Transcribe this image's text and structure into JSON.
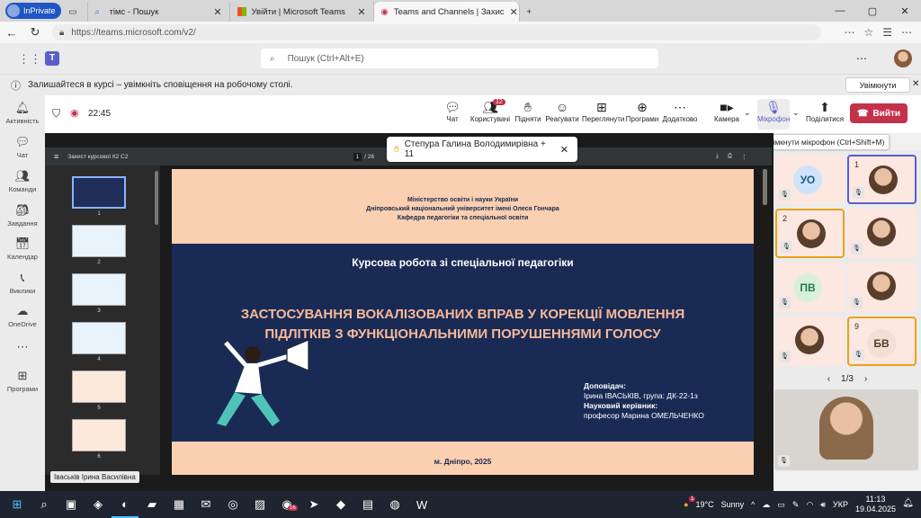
{
  "browser": {
    "inprivate_label": "InPrivate",
    "tabs": [
      {
        "title": "тімс - Пошук",
        "active": false
      },
      {
        "title": "Увійти | Microsoft Teams",
        "active": false
      },
      {
        "title": "Teams and Channels | Захис",
        "active": true
      }
    ],
    "url": "https://teams.microsoft.com/v2/"
  },
  "teams": {
    "search_placeholder": "Пошук (Ctrl+Alt+E)",
    "banner_text": "Залишайтеся в курсі – увімкніть сповіщення на робочому столі.",
    "banner_button": "Увімкнути",
    "rail": [
      "Активність",
      "Чат",
      "Команди",
      "Завдання",
      "Календар",
      "Виклики",
      "OneDrive",
      "Програми"
    ],
    "meeting": {
      "timer": "22:45",
      "toolbar": [
        {
          "label": "Чат",
          "icon": "chat-icon"
        },
        {
          "label": "Користувачі",
          "icon": "people-icon",
          "badge": "12"
        },
        {
          "label": "Підняти",
          "icon": "raise-hand-icon"
        },
        {
          "label": "Реагувати",
          "icon": "smiley-icon"
        },
        {
          "label": "Переглянути",
          "icon": "view-icon"
        },
        {
          "label": "Програми",
          "icon": "apps-icon"
        },
        {
          "label": "Додатково",
          "icon": "more-icon"
        },
        {
          "label": "Камера",
          "icon": "camera-icon"
        },
        {
          "label": "Мікрофон",
          "icon": "mic-off-icon"
        },
        {
          "label": "Поділитися",
          "icon": "share-icon"
        }
      ],
      "leave_label": "Вийти",
      "mic_tooltip": "Увімкнути мікрофон (Ctrl+Shift+M)"
    },
    "presenter_pill": "Степура Галина Володимирівна + 11",
    "presenter_badge": "Іваськів Ірина Василівна",
    "pdf": {
      "title": "Захист курсової К2 С2",
      "page": "1",
      "total": "/ 28",
      "thumb_numbers": [
        "1",
        "2",
        "3",
        "4",
        "5",
        "6"
      ]
    },
    "slide": {
      "ministry": "Міністерство освіти і науки України",
      "university": "Дніпровський національний університет імені Олеся Гончара",
      "department": "Кафедра педагогіки та спеціальної освіти",
      "course": "Курсова робота зі спеціальної педагогіки",
      "title_line1": "ЗАСТОСУВАННЯ ВОКАЛІЗОВАНИХ ВПРАВ У КОРЕКЦІЇ МОВЛЕННЯ",
      "title_line2": "ПІДЛІТКІВ З ФУНКЦІОНАЛЬНИМИ ПОРУШЕННЯМИ ГОЛОСУ",
      "speaker_label": "Доповідач:",
      "speaker": "Ірина ІВАСЬКІВ, група: ДК-22-1з",
      "advisor_label": "Науковий керівник:",
      "advisor": "професор Марина ОМЕЛЬЧЕНКО",
      "city_year": "м. Дніпро, 2025"
    },
    "participants": [
      {
        "initials": "УО",
        "color": "#1a5a8a"
      },
      {
        "hand": "1",
        "photo": true
      },
      {
        "hand": "2",
        "photo": true
      },
      {
        "photo": true
      },
      {
        "initials": "ПВ",
        "color": "#2a7a4a"
      },
      {
        "photo": true
      },
      {
        "photo": true
      },
      {
        "hand": "9",
        "initials": "БВ",
        "color": "#5a3e2c"
      }
    ],
    "pager": "1/3"
  },
  "taskbar": {
    "weather_temp": "19°C",
    "weather_text": "Sunny",
    "lang": "УКР",
    "time": "11:13",
    "date": "19.04.2025",
    "badges": {
      "viber": "16",
      "weather": "1"
    }
  }
}
